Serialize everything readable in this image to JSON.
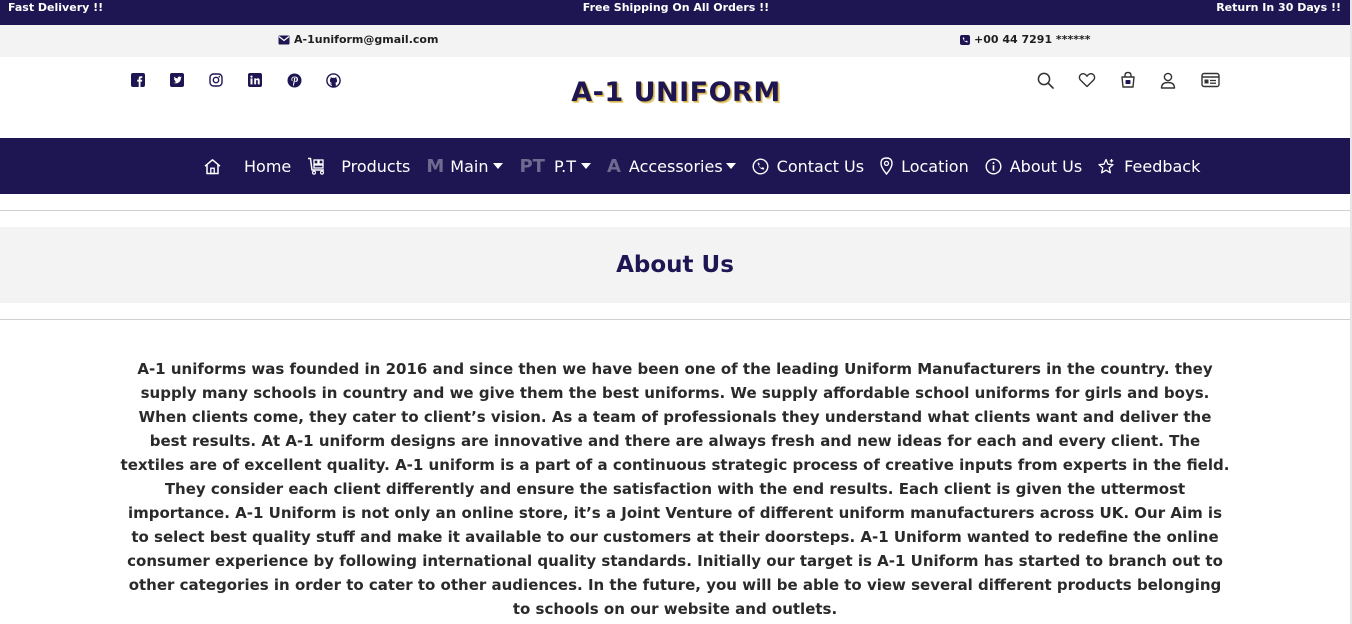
{
  "topbar": {
    "left": "Fast Delivery !!",
    "center": "Free Shipping On All Orders !!",
    "right": "Return In 30 Days !!"
  },
  "contact": {
    "email": "A-1uniform@gmail.com",
    "phone": "+00 44 7291 ******"
  },
  "brand": {
    "logo": "A-1 UNIFORM"
  },
  "socials": [
    "facebook-icon",
    "twitter-icon",
    "instagram-icon",
    "linkedin-icon",
    "pinterest-icon",
    "github-icon"
  ],
  "actions": [
    "search-icon",
    "heart-icon",
    "cart-icon",
    "user-icon",
    "account-card-icon"
  ],
  "nav": {
    "home": "Home",
    "products": "Products",
    "main_letter": "M",
    "main": "Main",
    "pt_letter": "PT",
    "pt": "P.T",
    "acc_letter": "A",
    "accessories": "Accessories",
    "contact": "Contact Us",
    "location": "Location",
    "about": "About Us",
    "feedback": "Feedback"
  },
  "page": {
    "title": "About Us",
    "body": "A-1 uniforms was founded in 2016 and since then we have been one of the leading Uniform Manufacturers in the country. they supply many schools in country and we give them the best uniforms. We supply affordable school uniforms for girls and boys. When clients come, they cater to client’s vision. As a team of professionals they understand what clients want and deliver the best results. At A-1 uniform designs are innovative and there are always fresh and new ideas for each and every client. The textiles are of excellent quality. A-1 uniform is a part of a continuous strategic process of creative inputs from experts in the field. They consider each client differently and ensure the satisfaction with the end results. Each client is given the uttermost importance. A-1 Uniform is not only an online store, it’s a Joint Venture of different uniform manufacturers across UK. Our Aim is to select best quality stuff and make it available to our customers at their doorsteps. A-1 Uniform wanted to redefine the online consumer experience by following international quality standards. Initially our target is A-1 Uniform has started to branch out to other categories in order to cater to other audiences. In the future, you will be able to view several different products belonging to schools on our website and outlets."
  },
  "colors": {
    "brand": "#1e1652",
    "band": "#f3f3f3",
    "logo_shadow": "#d4b24a"
  }
}
